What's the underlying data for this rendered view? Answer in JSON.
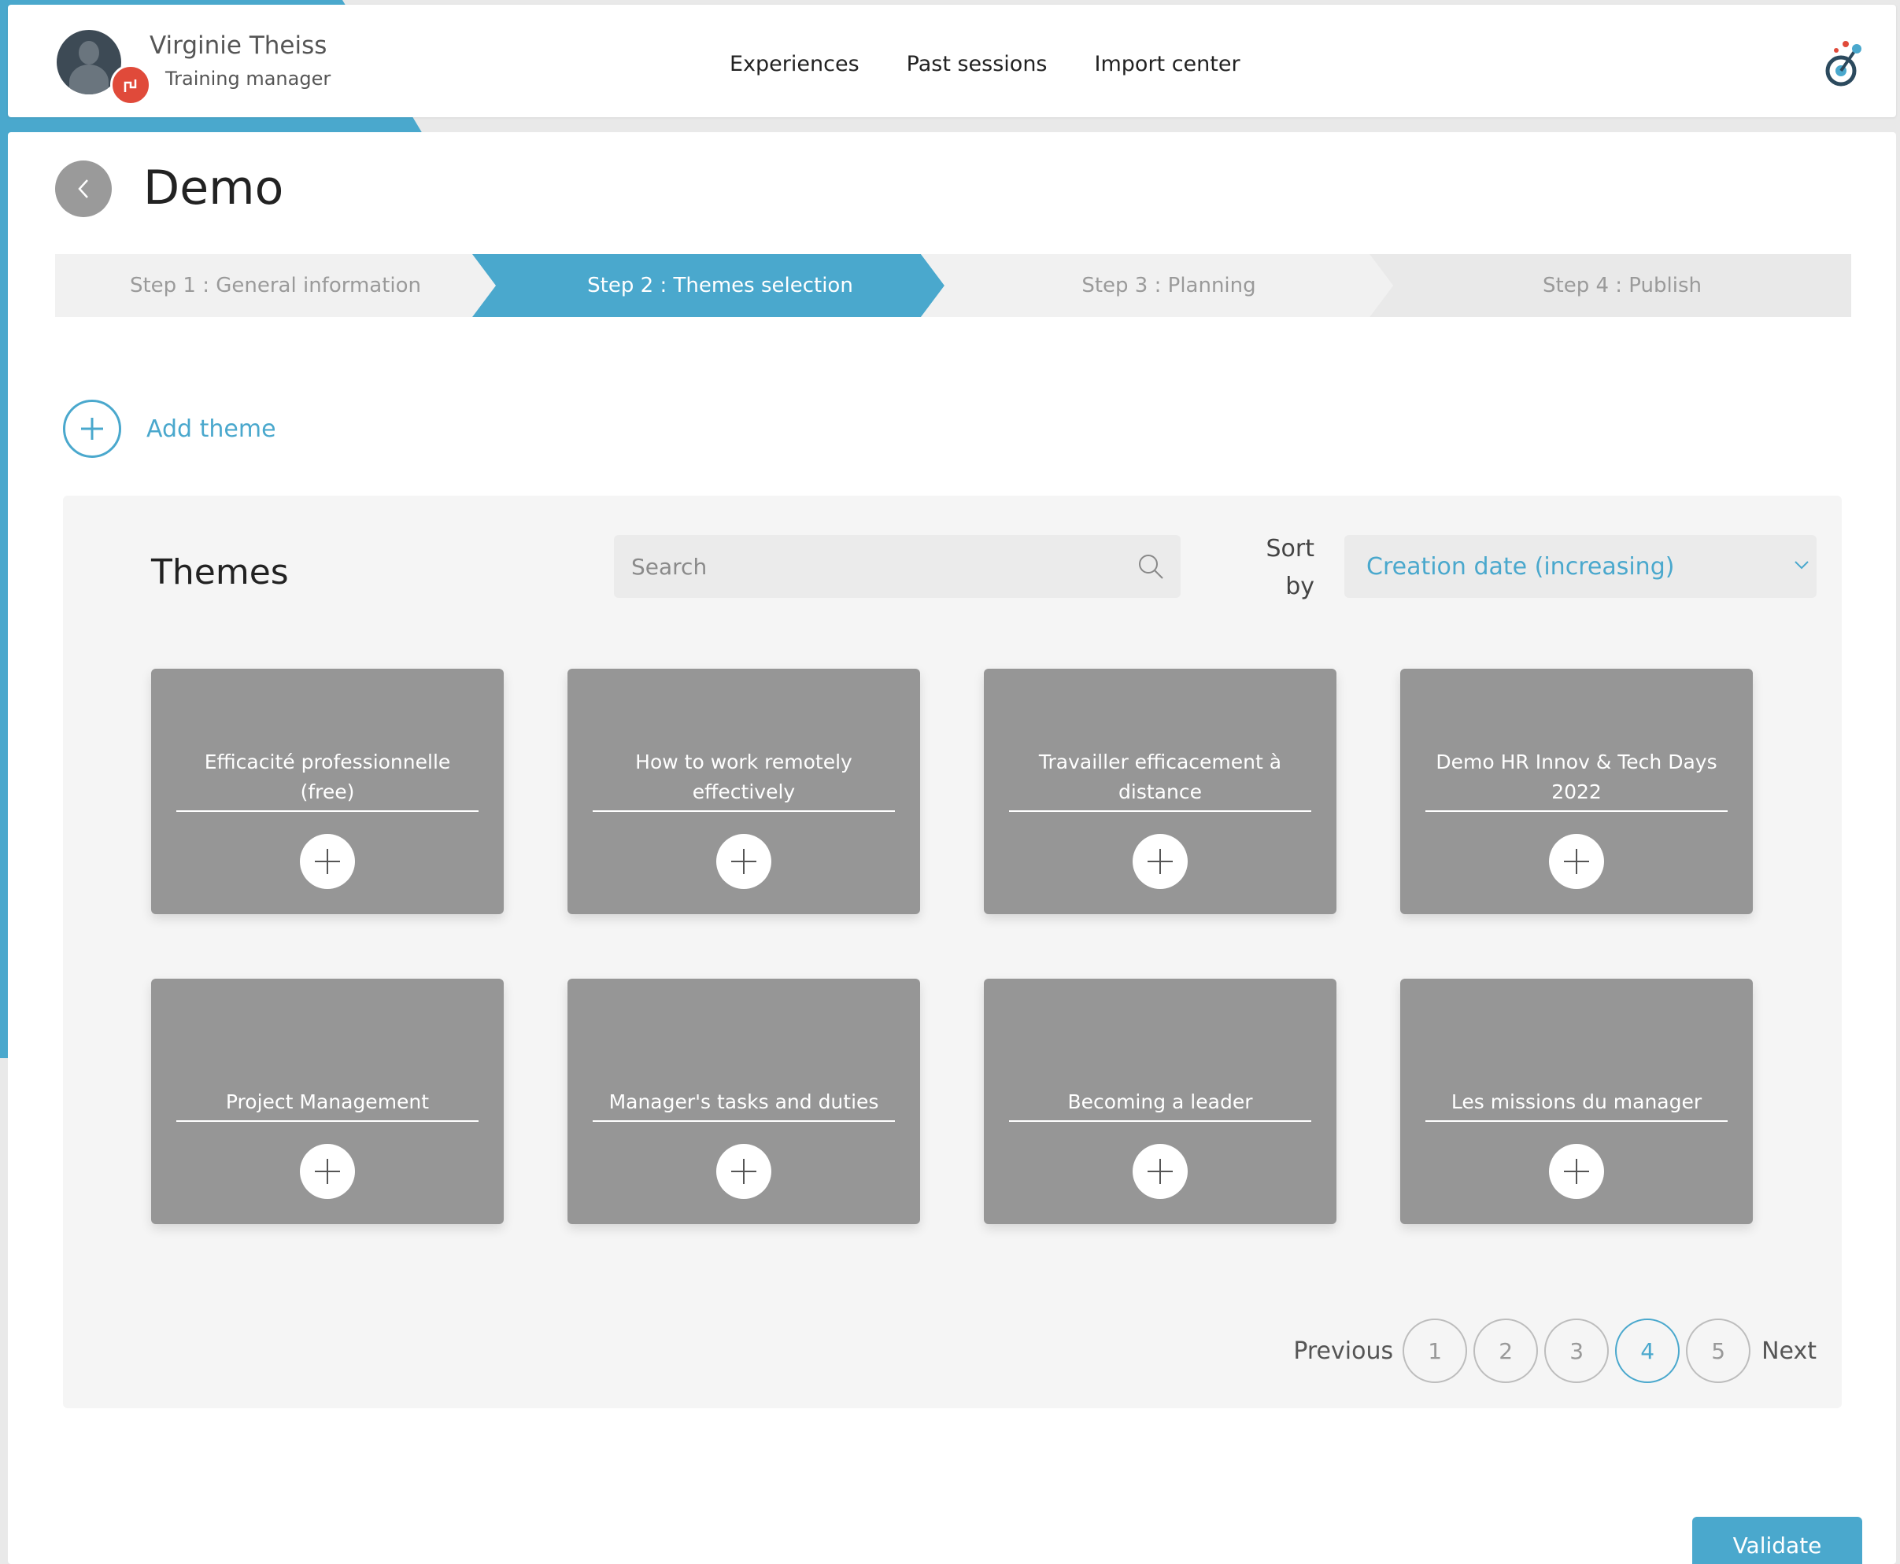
{
  "user": {
    "name": "Virginie Theiss",
    "role": "Training manager"
  },
  "nav": [
    "Experiences",
    "Past sessions",
    "Import center"
  ],
  "page": {
    "title": "Demo"
  },
  "steps": [
    "Step 1 : General information",
    "Step 2 : Themes selection",
    "Step 3 : Planning",
    "Step 4 : Publish"
  ],
  "active_step": 2,
  "add_theme_label": "Add theme",
  "themes": {
    "title": "Themes",
    "search_placeholder": "Search",
    "sort_label": "Sort by",
    "sort_value": "Creation date (increasing)",
    "cards": [
      "Efficacité professionnelle (free)",
      "How to work remotely effectively",
      "Travailler efficacement à distance",
      "Demo HR Innov & Tech Days 2022",
      "Project Management",
      "Manager's tasks and duties",
      "Becoming a leader",
      "Les missions du manager"
    ]
  },
  "pagination": {
    "previous": "Previous",
    "next": "Next",
    "pages": [
      "1",
      "2",
      "3",
      "4",
      "5"
    ],
    "current": "4"
  },
  "validate_label": "Validate",
  "colors": {
    "accent": "#4aa8cd",
    "card": "#969696",
    "badge": "#e04a3a"
  }
}
